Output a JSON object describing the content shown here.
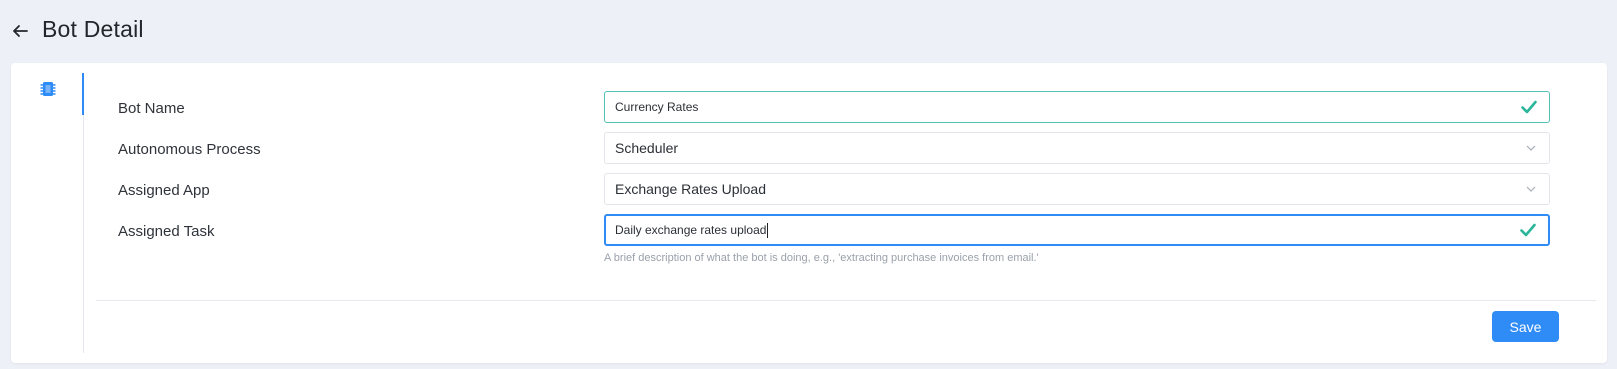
{
  "header": {
    "title": "Bot Detail",
    "back_icon": "arrow-left-icon"
  },
  "sidebar": {
    "active_tab_icon": "chip-icon",
    "accent_color": "#2f8bf5"
  },
  "form": {
    "bot_name": {
      "label": "Bot Name",
      "value": "Currency Rates",
      "status": "valid"
    },
    "autonomous_process": {
      "label": "Autonomous Process",
      "selected": "Scheduler"
    },
    "assigned_app": {
      "label": "Assigned App",
      "selected": "Exchange Rates Upload"
    },
    "assigned_task": {
      "label": "Assigned Task",
      "value": "Daily exchange rates upload",
      "status": "valid",
      "hint": "A brief description of what the bot is doing, e.g., 'extracting purchase invoices from email.'"
    }
  },
  "actions": {
    "save_label": "Save"
  },
  "colors": {
    "primary": "#2f8bf5",
    "success": "#2bb59a",
    "background": "#edf0f6"
  }
}
